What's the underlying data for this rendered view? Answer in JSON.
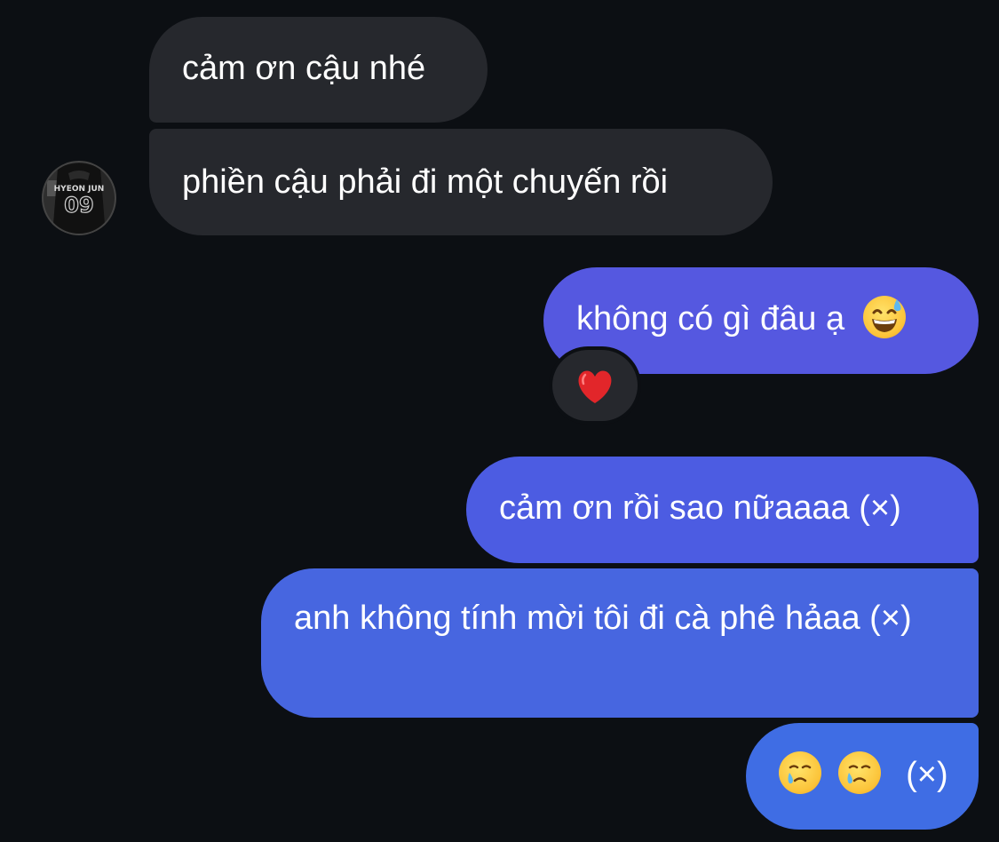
{
  "conversation": {
    "incoming": [
      {
        "text": "cảm ơn cậu nhé"
      },
      {
        "text": "phiền cậu phải đi một chuyến rồi"
      }
    ],
    "avatar": {
      "name_on_shirt": "HYEON JUN",
      "number_on_shirt": "09"
    },
    "outgoing": [
      {
        "text": "không có gì đâu ạ",
        "emoji": "grinning-face-with-sweat-icon"
      },
      {
        "text": "cảm ơn rồi sao nữaaaa (×)"
      },
      {
        "text": "anh không tính mời tôi đi cà phê hảaa (×)"
      },
      {
        "text": "(×)",
        "emojis": [
          "face-holding-back-tears-icon",
          "face-holding-back-tears-icon"
        ]
      }
    ],
    "reaction": {
      "emoji": "red-heart-icon"
    }
  },
  "colors": {
    "background": "#0c0f13",
    "incoming_bubble": "#26282d",
    "outgoing_bubble_top": "#5558e0",
    "outgoing_bubble_bottom": "#3f6de4",
    "text": "#ffffff"
  }
}
